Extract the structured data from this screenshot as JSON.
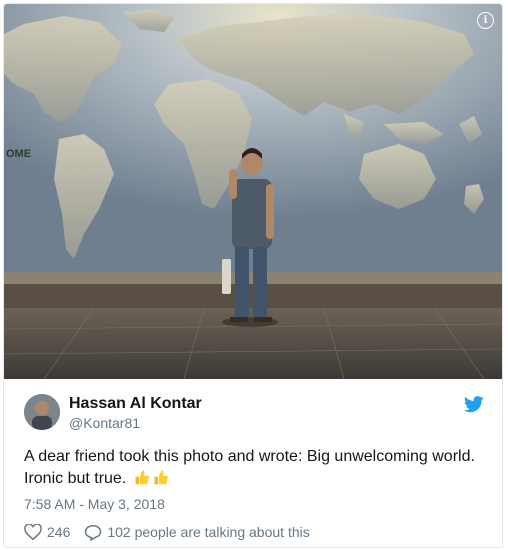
{
  "tweet": {
    "author_name": "Hassan Al Kontar",
    "author_handle": "@Kontar81",
    "text_line1": "A dear friend took this photo and wrote: Big unwelcoming world.",
    "text_line2": "Ironic but true.",
    "emoji": [
      "thumbs-up",
      "thumbs-up"
    ],
    "timestamp": "7:58 AM - May 3, 2018",
    "like_count": "246",
    "conversation_text": "102 people are talking about this"
  },
  "photo": {
    "wall_text": "OME",
    "info_label": "i"
  },
  "colors": {
    "twitter_blue": "#1da1f2",
    "text_primary": "#14171a",
    "text_secondary": "#657786"
  },
  "icons": {
    "info": "info-icon",
    "brand": "twitter-bird-icon",
    "like": "heart-icon",
    "reply": "speech-bubble-icon",
    "emoji": "thumbs-up-icon"
  }
}
